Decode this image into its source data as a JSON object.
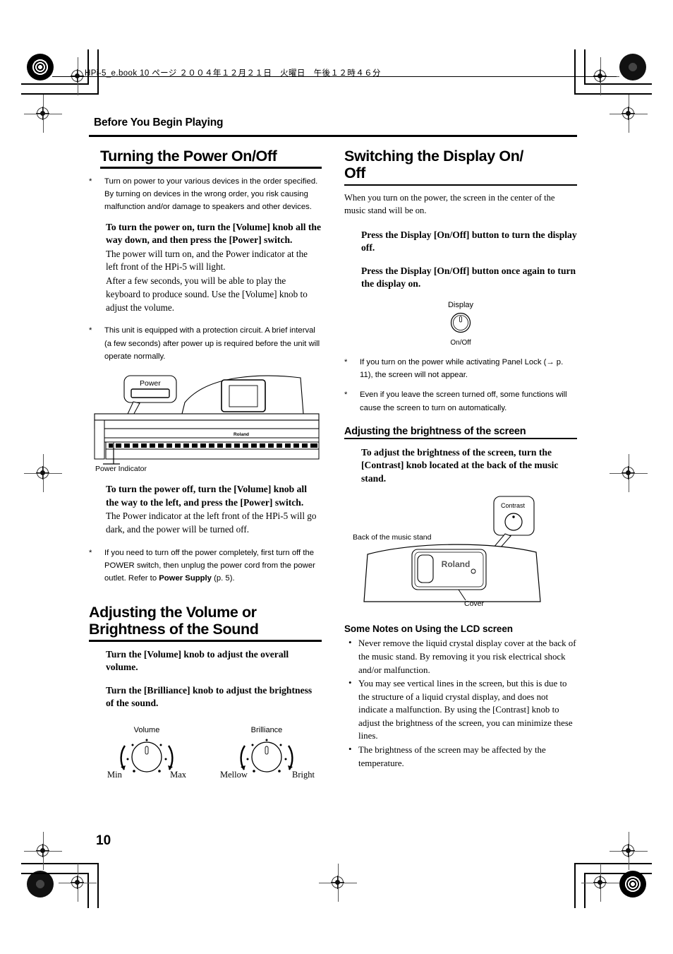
{
  "header": {
    "book_info": "HPi-5_e.book  10 ページ  ２００４年１２月２１日　火曜日　午後１２時４６分"
  },
  "running_head": "Before You Begin Playing",
  "page_number": "10",
  "left_column": {
    "section_title": "Turning the Power On/Off",
    "note_1": "Turn on power to your various devices in the order specified. By turning on devices in the wrong order, you risk causing malfunction and/or damage to speakers and other devices.",
    "instruction_on_lead": "To turn the power on, turn the [Volume] knob all the way down, and then press the [Power] switch.",
    "instruction_on_body_1": "The power will turn on, and the Power indicator at the left front of the HPi-5 will light.",
    "instruction_on_body_2": "After a few seconds, you will be able to play the keyboard to produce sound. Use the [Volume] knob to adjust the volume.",
    "note_2": "This unit is equipped with a protection circuit. A brief interval (a few seconds) after power up is required before the unit will operate normally.",
    "figure_piano": {
      "callout_label": "Power",
      "indicator_label": "Power Indicator",
      "brand_label": "Roland"
    },
    "instruction_off_lead": "To turn the power off, turn the [Volume] knob all the way to the left, and press the [Power] switch.",
    "instruction_off_body": "The Power indicator at the left front of the HPi-5 will go dark, and the power will be turned off.",
    "note_3_part1": "If you need to turn off the power completely, first turn off the POWER switch, then unplug the power cord from the power outlet. Refer to ",
    "note_3_bold": "Power Supply",
    "note_3_part2": " (p. 5).",
    "section2_title_line1": "Adjusting the Volume or",
    "section2_title_line2": "Brightness of the Sound",
    "instruction_volume": "Turn the [Volume] knob to adjust the overall volume.",
    "instruction_brilliance": "Turn the [Brilliance] knob to adjust the brightness of the sound.",
    "figure_knobs": {
      "volume_title": "Volume",
      "volume_min": "Min",
      "volume_max": "Max",
      "brilliance_title": "Brilliance",
      "brilliance_min": "Mellow",
      "brilliance_max": "Bright"
    }
  },
  "right_column": {
    "section_title_line1": "Switching the Display On/",
    "section_title_line2": "Off",
    "intro": "When you turn on the power, the screen in the center of the music stand will be on.",
    "instruction_off": "Press the Display [On/Off] button to turn the display off.",
    "instruction_on": "Press the Display [On/Off] button once again to turn the display on.",
    "figure_display": {
      "title": "Display",
      "sublabel": "On/Off"
    },
    "note_1": "If you turn on the power while activating Panel Lock (→ p. 11), the screen will not appear.",
    "note_2": "Even if you leave the screen turned off, some functions will cause the screen to turn on automatically.",
    "subsection_title": "Adjusting the brightness of the screen",
    "instruction_contrast": "To adjust the brightness of the screen, turn the [Contrast] knob located at the back of the music stand.",
    "figure_stand": {
      "callout_label": "Contrast",
      "back_label": "Back of the music stand",
      "brand_label": "Roland",
      "cover_label": "Cover"
    },
    "notes_title": "Some Notes on Using the LCD screen",
    "notes": [
      "Never remove the liquid crystal display cover at the back of the music stand. By removing it you risk electrical shock and/or malfunction.",
      "You may see vertical lines in the screen, but this is due to the structure of a liquid crystal display, and does not indicate a malfunction. By using the [Contrast] knob to adjust the brightness of the screen, you can minimize these lines.",
      "The brightness of the screen may be affected by the temperature."
    ]
  }
}
